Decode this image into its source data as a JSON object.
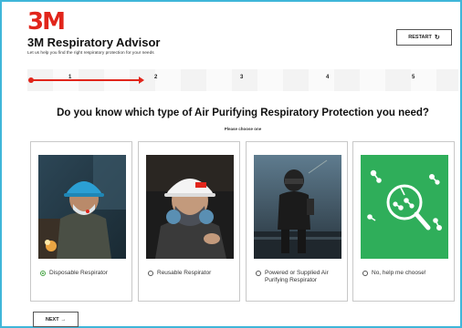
{
  "brand": {
    "logo": "3M",
    "color": "#e1251b"
  },
  "header": {
    "title": "3M Respiratory Advisor",
    "subtitle": "Let us help you find the right respiratory protection for your needs",
    "restart_label": "RESTART",
    "restart_icon": "↻"
  },
  "stepper": {
    "steps": [
      "1",
      "2",
      "3",
      "4",
      "5"
    ],
    "current_step": 1,
    "accent": "#e1251b"
  },
  "question": {
    "title": "Do you know which type of Air Purifying Respiratory Protection you need?",
    "hint": "Please choose one"
  },
  "options": [
    {
      "label": "Disposable Respirator",
      "selected": true
    },
    {
      "label": "Reusable Respirator",
      "selected": false
    },
    {
      "label": "Powered or Supplied Air Purifying Respirator",
      "selected": false
    },
    {
      "label": "No, help me choose!",
      "selected": false
    }
  ],
  "footer": {
    "next_label": "NEXT",
    "next_icon": "→"
  },
  "colors": {
    "frame": "#3fb6d9",
    "selected": "#46a443",
    "help_tile": "#2fae5a"
  }
}
